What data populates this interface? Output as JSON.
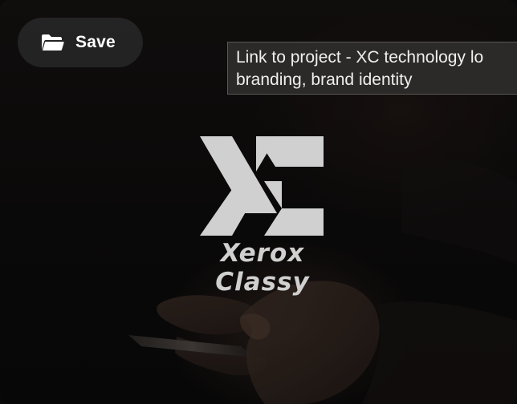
{
  "save_button": {
    "label": "Save",
    "icon": "folder-icon"
  },
  "tooltip": {
    "line1": "Link to project - XC technology lo",
    "line2": "branding, brand identity"
  },
  "logo": {
    "monogram": "XC",
    "wordmark": "Xerox Classy",
    "color": "#d0d0d0"
  },
  "colors": {
    "background": "#0b0a0a",
    "button_bg": "#262626",
    "tooltip_bg": "#2b2a28",
    "tooltip_border": "#5a5853"
  }
}
